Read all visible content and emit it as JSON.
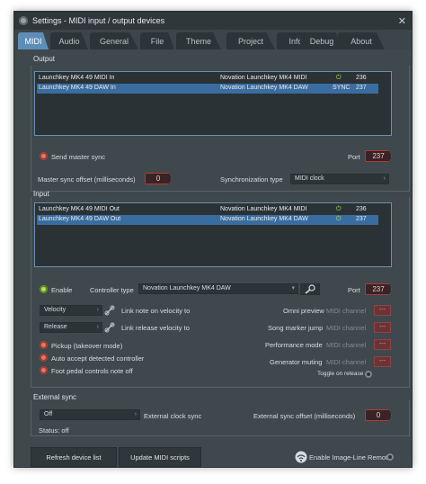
{
  "window": {
    "title": "Settings - MIDI input / output devices",
    "close": "✕"
  },
  "tabs": [
    {
      "label": "MIDI",
      "active": true
    },
    {
      "label": "Audio"
    },
    {
      "label": "General"
    },
    {
      "label": "File"
    },
    {
      "label": "Theme"
    },
    {
      "label": "Project"
    },
    {
      "label": "Info"
    },
    {
      "label": "Debug"
    },
    {
      "label": "About"
    }
  ],
  "output": {
    "section_label": "Output",
    "rows": [
      {
        "device": "Launchkey MK4 49 MIDI In",
        "driver": "Novation Launchkey MK4 MIDI",
        "status": "⏻",
        "port": "236",
        "selected": false
      },
      {
        "device": "Launchkey MK4 49 DAW In",
        "driver": "Novation Launchkey MK4 DAW",
        "status": "SYNC",
        "port": "237",
        "selected": true
      }
    ],
    "send_master_sync": "Send master sync",
    "port_label": "Port",
    "port_value": "237",
    "master_sync_offset_label": "Master sync offset (milliseconds)",
    "master_sync_offset_value": "0",
    "sync_type_label": "Synchronization type",
    "sync_type_value": "MIDI clock",
    "sync_type_arrow": "›"
  },
  "input": {
    "section_label": "Input",
    "rows": [
      {
        "device": "Launchkey MK4 49 MIDI Out",
        "driver": "Novation Launchkey MK4 MIDI",
        "status": "⏻",
        "port": "236",
        "selected": false
      },
      {
        "device": "Launchkey MK4 49 DAW Out",
        "driver": "Novation Launchkey MK4 DAW",
        "status": "⏻",
        "port": "237",
        "selected": true
      }
    ],
    "enable_label": "Enable",
    "controller_type_label": "Controller type",
    "controller_type_value": "Novation Launchkey MK4 DAW",
    "controller_type_arrow": "▾",
    "port_label": "Port",
    "port_value": "237",
    "velocity_select": "Velocity",
    "velocity_link_label": "Link note on velocity to",
    "release_select": "Release",
    "release_link_label": "Link release velocity to",
    "select_arrow": "›",
    "options": [
      "Pickup (takeover mode)",
      "Auto accept detected controller",
      "Foot pedal controls note off"
    ],
    "omni_preview": "Omni preview",
    "song_marker_jump": "Song marker jump",
    "performance_mode": "Performance mode",
    "generator_muting": "Generator muting",
    "midi_channel": "MIDI channel",
    "channel_value": "---",
    "toggle_on_release": "Toggle on release"
  },
  "external_sync": {
    "section_label": "External sync",
    "clock_select": "Off",
    "clock_arrow": "›",
    "clock_label": "External clock sync",
    "offset_label": "External sync offset (milliseconds)",
    "offset_value": "0",
    "status": "Status: off"
  },
  "footer": {
    "refresh_button": "Refresh device list",
    "update_button": "Update MIDI scripts",
    "remote_label": "Enable Image-Line Remote"
  },
  "colors": {
    "accent": "#5d8eb8",
    "selected_row": "#3a6d9f",
    "port_red": "#b23a36",
    "led_green": "#b7e26a",
    "led_red": "#e27868"
  }
}
